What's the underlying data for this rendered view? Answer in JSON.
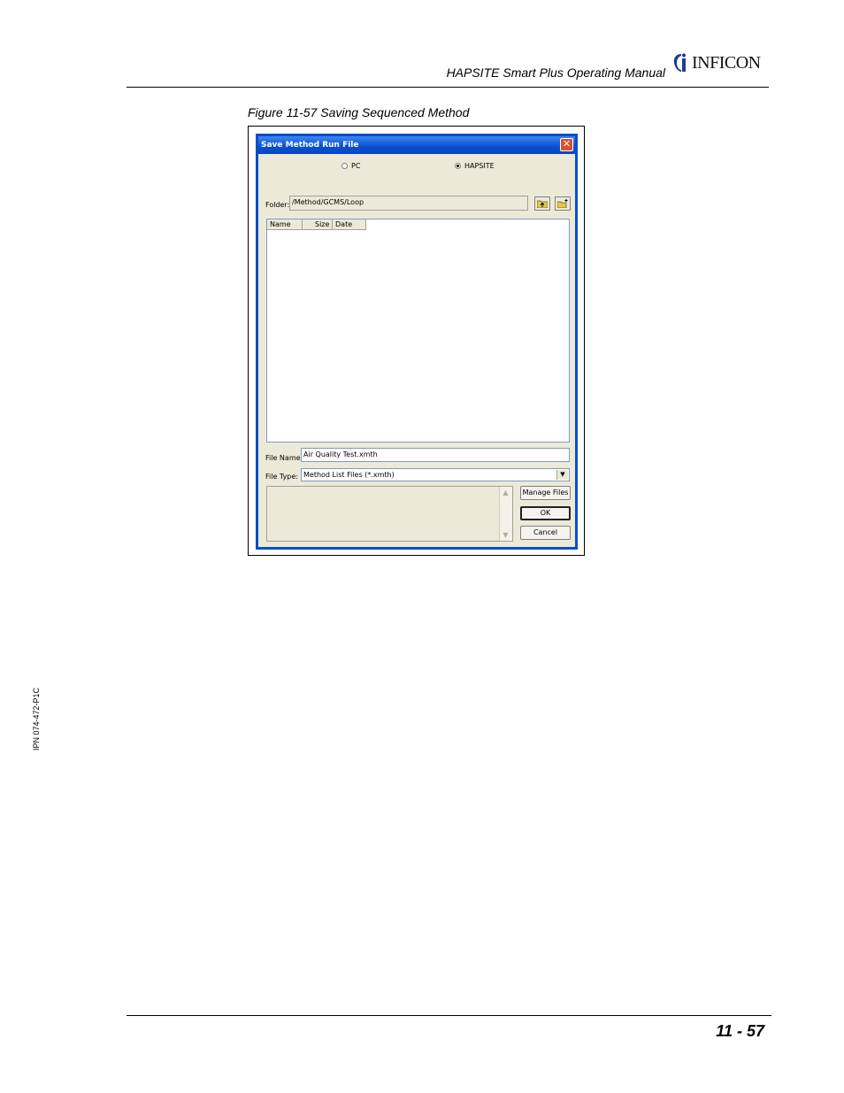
{
  "header": {
    "title": "HAPSITE Smart Plus Operating Manual",
    "logo_text": "INFICON",
    "logo_icon": "inficon-logo-mark"
  },
  "figure": {
    "caption": "Figure 11-57  Saving Sequenced Method"
  },
  "dialog": {
    "title": "Save Method Run File",
    "location_options": [
      {
        "label": "PC",
        "selected": false
      },
      {
        "label": "HAPSITE",
        "selected": true
      }
    ],
    "folder_label": "Folder:",
    "folder_value": "/Method/GCMS/Loop",
    "toolbar_icons": [
      "folder-up-icon",
      "new-folder-icon"
    ],
    "columns": [
      "Name",
      "Size",
      "Date"
    ],
    "rows": [],
    "file_name_label": "File Name:",
    "file_name_value": "Air Quality Test.xmth",
    "file_type_label": "File Type:",
    "file_type_value": "Method List Files (*.xmth)",
    "buttons": {
      "manage": "Manage Files",
      "ok": "OK",
      "cancel": "Cancel"
    }
  },
  "side_doc_id": "IPN 074-472-P1C",
  "page_number": "11 - 57"
}
